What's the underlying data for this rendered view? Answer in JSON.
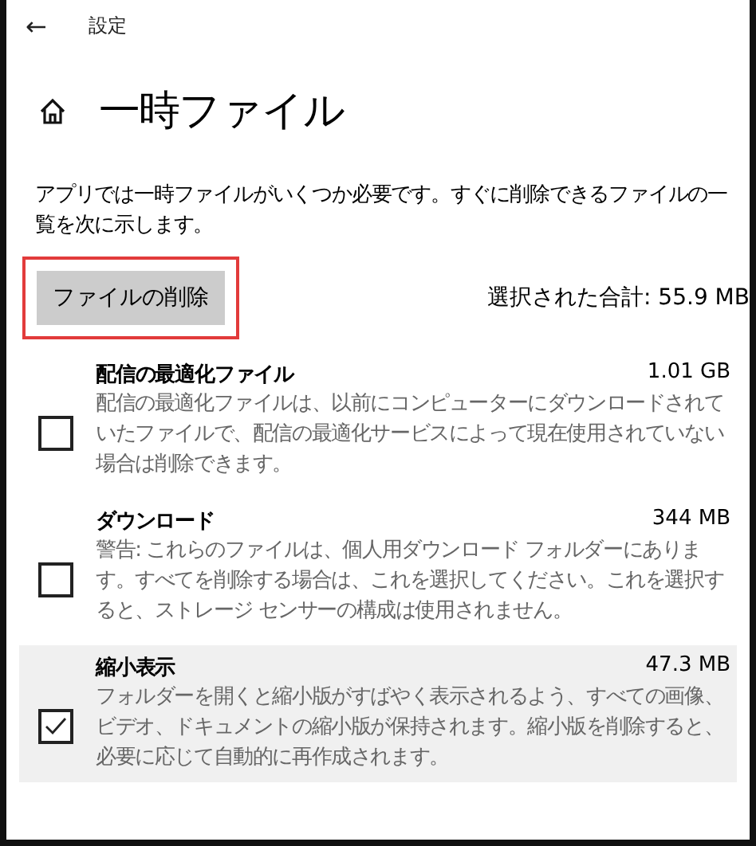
{
  "header": {
    "back": "←",
    "title": "設定"
  },
  "page": {
    "title": "一時ファイル",
    "description": "アプリでは一時ファイルがいくつか必要です。すぐに削除できるファイルの一覧を次に示します。"
  },
  "delete_button": {
    "label": "ファイルの削除",
    "annotated": true
  },
  "total": "選択された合計: 55.9 MB",
  "items": [
    {
      "name": "配信の最適化ファイル",
      "size": "1.01 GB",
      "description": "配信の最適化ファイルは、以前にコンピューターにダウンロードされていたファイルで、配信の最適化サービスによって現在使用されていない場合は削除できます。",
      "checked": false,
      "highlighted": false
    },
    {
      "name": "ダウンロード",
      "size": "344 MB",
      "description": "警告: これらのファイルは、個人用ダウンロード フォルダーにあります。すべてを削除する場合は、これを選択してください。これを選択すると、ストレージ センサーの構成は使用されません。",
      "checked": false,
      "highlighted": false
    },
    {
      "name": "縮小表示",
      "size": "47.3 MB",
      "description": "フォルダーを開くと縮小版がすばやく表示されるよう、すべての画像、ビデオ、ドキュメントの縮小版が保持されます。縮小版を削除すると、必要に応じて自動的に再作成されます。",
      "checked": true,
      "highlighted": true
    }
  ]
}
